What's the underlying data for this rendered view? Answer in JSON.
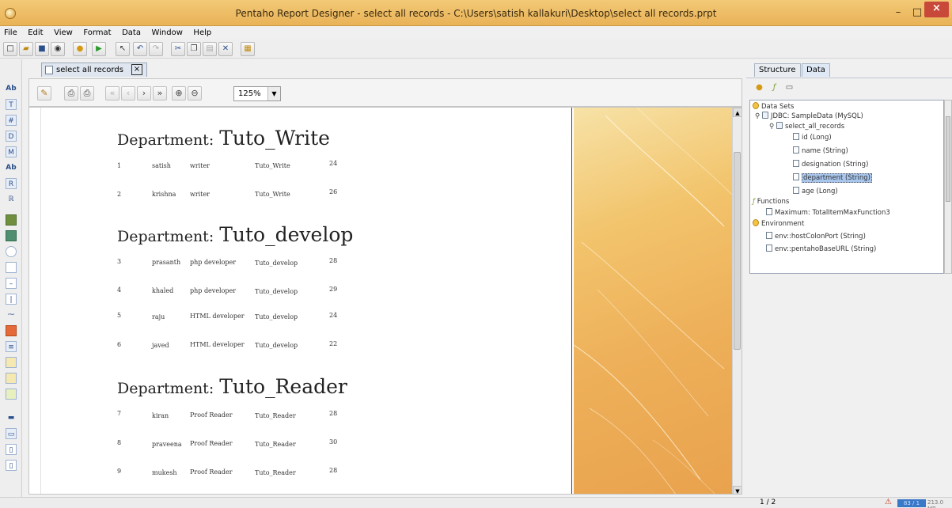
{
  "window": {
    "title": "Pentaho Report Designer - select all records - C:\\Users\\satish kallakuri\\Desktop\\select all records.prpt",
    "minimize": "–",
    "maximize": "□",
    "close": "×"
  },
  "menu": [
    "File",
    "Edit",
    "View",
    "Format",
    "Data",
    "Window",
    "Help"
  ],
  "document_tab": {
    "label": "select all records",
    "close": "×"
  },
  "preview": {
    "zoom": "125%"
  },
  "report": {
    "dept_label": "Department:",
    "groups": [
      {
        "department": "Tuto_Write",
        "rows": [
          {
            "id": "1",
            "name": "satish",
            "designation": "writer",
            "dept": "Tuto_Write",
            "age": "24"
          },
          {
            "id": "2",
            "name": "krishna",
            "designation": "writer",
            "dept": "Tuto_Write",
            "age": "26"
          }
        ]
      },
      {
        "department": "Tuto_develop",
        "rows": [
          {
            "id": "3",
            "name": "prasanth",
            "designation": "php developer",
            "dept": "Tuto_develop",
            "age": "28"
          },
          {
            "id": "4",
            "name": "khaled",
            "designation": "php developer",
            "dept": "Tuto_develop",
            "age": "29"
          },
          {
            "id": "5",
            "name": "raju",
            "designation": "HTML developer",
            "dept": "Tuto_develop",
            "age": "24"
          },
          {
            "id": "6",
            "name": "javed",
            "designation": "HTML developer",
            "dept": "Tuto_develop",
            "age": "22"
          }
        ]
      },
      {
        "department": "Tuto_Reader",
        "rows": [
          {
            "id": "7",
            "name": "kiran",
            "designation": "Proof Reader",
            "dept": "Tuto_Reader",
            "age": "28"
          },
          {
            "id": "8",
            "name": "praveena",
            "designation": "Proof Reader",
            "dept": "Tuto_Reader",
            "age": "30"
          },
          {
            "id": "9",
            "name": "mukesh",
            "designation": "Proof Reader",
            "dept": "Tuto_Reader",
            "age": "28"
          }
        ]
      }
    ]
  },
  "right_panel": {
    "tabs": [
      "Structure",
      "Data"
    ],
    "active_tab": "Data",
    "tree": {
      "data_sets": "Data Sets",
      "jdbc": "JDBC: SampleData (MySQL)",
      "query": "select_all_records",
      "fields": [
        "id (Long)",
        "name (String)",
        "designation (String)",
        "department (String)",
        "age (Long)"
      ],
      "selected_field": "department (String)",
      "functions": "Functions",
      "function_item": "Maximum: TotalItemMaxFunction3",
      "environment": "Environment",
      "env_items": [
        "env::hostColonPort (String)",
        "env::pentahoBaseURL (String)"
      ]
    }
  },
  "status": {
    "page": "1 / 2",
    "memory": "83 / 1",
    "memory_total": "213.0 MB"
  }
}
